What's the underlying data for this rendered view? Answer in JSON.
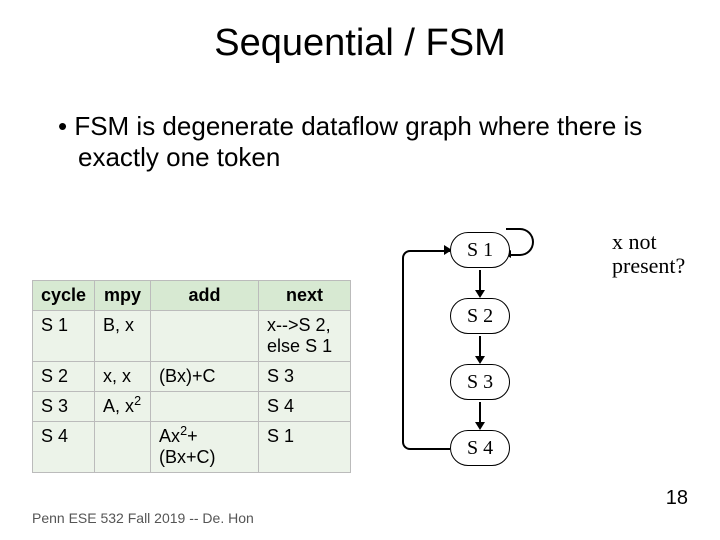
{
  "title": "Sequential / FSM",
  "bullet": "FSM is degenerate dataflow graph where there is exactly one token",
  "table": {
    "headers": {
      "cycle": "cycle",
      "mpy": "mpy",
      "add": "add",
      "next": "next"
    },
    "rows": [
      {
        "cycle": "S 1",
        "mpy": "B, x",
        "add": "",
        "next": "x-->S 2, else S 1"
      },
      {
        "cycle": "S 2",
        "mpy": "x, x",
        "add": "(Bx)+C",
        "next": "S 3"
      },
      {
        "cycle": "S 3",
        "mpy": "A, x",
        "mpy_sup": "2",
        "add": "",
        "next": "S 4"
      },
      {
        "cycle": "S 4",
        "mpy": "",
        "add_pre": "Ax",
        "add_sup": "2",
        "add_post": "+(Bx+C)",
        "next": "S 1"
      }
    ]
  },
  "states": {
    "s1": "S 1",
    "s2": "S 2",
    "s3": "S 3",
    "s4": "S 4"
  },
  "annotation": "x not present?",
  "footer": "Penn ESE 532 Fall 2019 -- De. Hon",
  "page": "18"
}
